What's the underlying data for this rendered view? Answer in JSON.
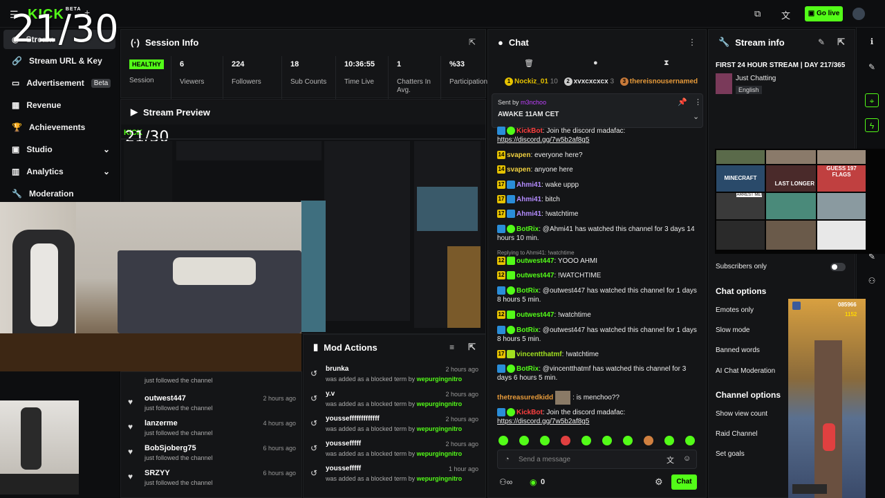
{
  "overlay": {
    "counter": "21/30"
  },
  "topbar": {
    "logo": "KICK",
    "logo_badge": "BETA",
    "go_live": "Go live"
  },
  "sidebar": {
    "items": [
      {
        "label": "Stream",
        "active": true
      },
      {
        "label": "Stream URL & Key"
      },
      {
        "label": "Advertisement",
        "badge": "Beta"
      },
      {
        "label": "Revenue"
      },
      {
        "label": "Achievements"
      },
      {
        "label": "Studio"
      },
      {
        "label": "Analytics"
      },
      {
        "label": "Moderation"
      }
    ]
  },
  "session": {
    "title": "Session Info",
    "status": "HEALTHY",
    "status_label": "Session",
    "stats": [
      {
        "value": "6",
        "label": "Viewers"
      },
      {
        "value": "224",
        "label": "Followers"
      },
      {
        "value": "18",
        "label": "Sub Counts"
      },
      {
        "value": "10:36:55",
        "label": "Time Live"
      },
      {
        "value": "1",
        "label": "Chatters In Avg."
      },
      {
        "value": "%33",
        "label": "Participation"
      }
    ]
  },
  "preview": {
    "title": "Stream Preview",
    "inner_counter": "21/30"
  },
  "activity": {
    "items": [
      {
        "name": "",
        "sub": "just followed the channel",
        "time": ""
      },
      {
        "name": "outwest447",
        "sub": "just followed the channel",
        "time": "2 hours ago"
      },
      {
        "name": "lanzerme",
        "sub": "just followed the channel",
        "time": "4 hours ago"
      },
      {
        "name": "BobSjoberg75",
        "sub": "just followed the channel",
        "time": "6 hours ago"
      },
      {
        "name": "SRZYY",
        "sub": "just followed the channel",
        "time": "6 hours ago"
      }
    ]
  },
  "mod_actions": {
    "title": "Mod Actions",
    "items": [
      {
        "name": "brunka",
        "sub": "was added as a blocked term by",
        "by": "wepurgingnitro",
        "time": "2 hours ago"
      },
      {
        "name": "y.v",
        "sub": "was added as a blocked term by",
        "by": "wepurgingnitro",
        "time": "2 hours ago"
      },
      {
        "name": "youssefffffffffffff",
        "sub": "was added as a blocked term by",
        "by": "wepurgingnitro",
        "time": "2 hours ago"
      },
      {
        "name": "youssefffff",
        "sub": "was added as a blocked term by",
        "by": "wepurgingnitro",
        "time": "2 hours ago"
      },
      {
        "name": "youssefffff",
        "sub": "was added as a blocked term by",
        "by": "wepurgingnitro",
        "time": "1 hour ago"
      }
    ]
  },
  "chat": {
    "title": "Chat",
    "leaders": [
      {
        "rank": "1",
        "name": "Nockiz_01",
        "count": "10"
      },
      {
        "rank": "2",
        "name": "xvxcxcxcx",
        "count": "3"
      },
      {
        "rank": "3",
        "name": "thereisnousernamed",
        "count": ""
      }
    ],
    "pinned": {
      "sent_by": "Sent by",
      "user": "m3nchoo",
      "text": "AWAKE 11AM CET"
    },
    "messages": [
      {
        "user": "KickBot",
        "text": ": Join the discord madafac:",
        "link": "https://discord.gg/7w5b2af8g5"
      },
      {
        "badge": "14",
        "user": "svapen",
        "text": ": everyone here?"
      },
      {
        "badge": "14",
        "user": "svapen",
        "text": ": anyone here"
      },
      {
        "badge": "17",
        "user": "Ahmi41",
        "text": ": wake uppp"
      },
      {
        "badge": "17",
        "user": "Ahmi41",
        "text": ": bitch"
      },
      {
        "badge": "17",
        "user": "Ahmi41",
        "text": ": !watchtime"
      },
      {
        "user": "BotRix",
        "text": ": @Ahmi41 has watched this channel for 3 days 14 hours 10 min."
      },
      {
        "reply": "Replying to Ahmi41: !watchtime"
      },
      {
        "badge": "12",
        "user": "outwest447",
        "text": ": YOOO AHMI"
      },
      {
        "badge": "12",
        "user": "outwest447",
        "text": ": !WATCHTIME"
      },
      {
        "user": "BotRix",
        "text": ": @outwest447 has watched this channel for 1 days 8 hours 5 min."
      },
      {
        "badge": "12",
        "user": "outwest447",
        "text": ": !watchtime"
      },
      {
        "user": "BotRix",
        "text": ": @outwest447 has watched this channel for 1 days 8 hours 5 min."
      },
      {
        "badge": "17",
        "user": "vincentthatmf",
        "text": ": !watchtime"
      },
      {
        "user": "BotRix",
        "text": ": @vincentthatmf has watched this channel for 3 days 6 hours 5 min."
      },
      {
        "user": "thetreasuredkidd",
        "text": ": is menchoo??"
      },
      {
        "user": "KickBot",
        "text": ": Join the discord madafac:",
        "link": "https://discord.gg/7w5b2af8g5"
      }
    ],
    "input_placeholder": "Send a message",
    "points": "0",
    "send_label": "Chat"
  },
  "stream_info": {
    "title": "Stream info",
    "stream_title": "FIRST 24 HOUR STREAM | DAY 217/365",
    "category": "Just Chatting",
    "language": "English",
    "subscribers_only": "Subscribers only",
    "chat_options_title": "Chat options",
    "chat_options": [
      "Emotes only",
      "Slow mode",
      "Banned words",
      "AI Chat Moderation"
    ],
    "channel_options_title": "Channel options",
    "channel_options": [
      "Show view count",
      "Raid Channel",
      "Set goals"
    ]
  },
  "thumbnails": {
    "labels": [
      "MINECRAFT",
      "LAST LONGER",
      "GUESS 197 FLAGS",
      "ARREST ME!"
    ]
  },
  "game": {
    "score": "085966",
    "coins": "1152"
  },
  "colors": {
    "accent": "#53fc18",
    "bg": "#0b0c0d",
    "panel": "#141517"
  }
}
